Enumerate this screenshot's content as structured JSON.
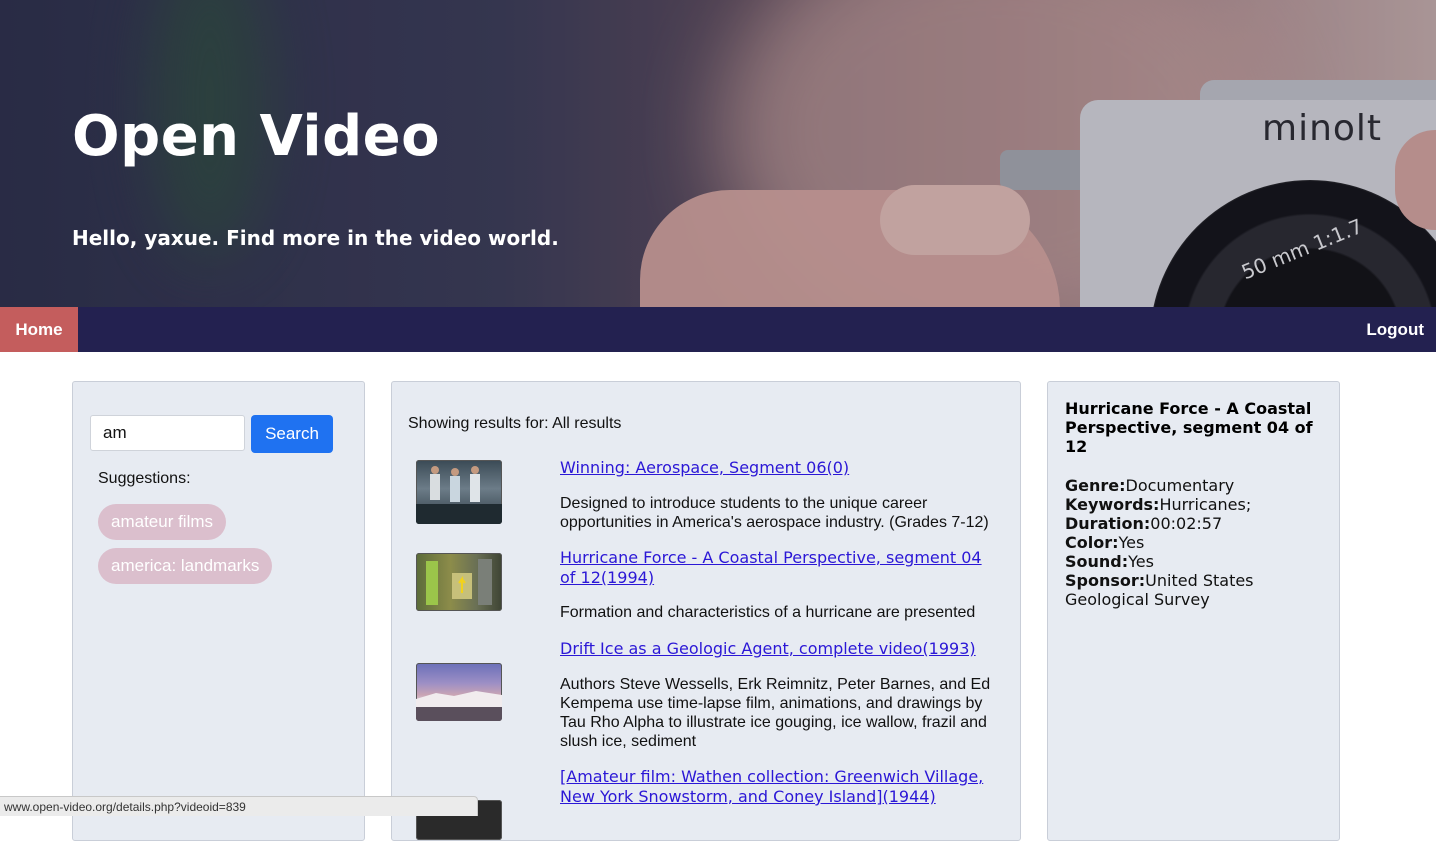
{
  "hero": {
    "title": "Open Video",
    "subtitle": "Hello, yaxue. Find more in the video world.",
    "camera_brand": "minolt",
    "lens_marking": "50 mm 1:1.7"
  },
  "nav": {
    "home_label": "Home",
    "logout_label": "Logout"
  },
  "search": {
    "value": "am",
    "button_label": "Search",
    "suggestions_label": "Suggestions:",
    "suggestions": [
      "amateur films",
      "america: landmarks"
    ]
  },
  "results": {
    "heading": "Showing results for: All results",
    "items": [
      {
        "title": "Winning: Aerospace, Segment 06(0)",
        "description": "Designed to introduce students to the unique career opportunities in America's aerospace industry. (Grades 7-12)"
      },
      {
        "title": "Hurricane Force - A Coastal Perspective, segment 04 of 12(1994)",
        "description": "Formation and characteristics of a hurricane are presented"
      },
      {
        "title": "Drift Ice as a Geologic Agent, complete video(1993)",
        "description": "Authors Steve Wessells, Erk Reimnitz, Peter Barnes, and Ed Kempema use time-lapse film, animations, and drawings by Tau Rho Alpha to illustrate ice gouging, ice wallow, frazil and slush ice, sediment"
      },
      {
        "title": "[Amateur film: Wathen collection: Greenwich Village, New York Snowstorm, and Coney Island](1944)",
        "description": ""
      }
    ]
  },
  "detail": {
    "title": "Hurricane Force - A Coastal Perspective, segment 04 of 12",
    "genre_label": "Genre:",
    "genre": "Documentary",
    "keywords_label": "Keywords:",
    "keywords": "Hurricanes;",
    "duration_label": "Duration:",
    "duration": "00:02:57",
    "color_label": "Color:",
    "color": "Yes",
    "sound_label": "Sound:",
    "sound": "Yes",
    "sponsor_label": "Sponsor:",
    "sponsor": "United States Geological Survey"
  },
  "status_bar": {
    "url": "www.open-video.org/details.php?videoid=839"
  },
  "colors": {
    "nav_bg": "#232150",
    "home_active": "#c45d5d",
    "search_button": "#1f72f1",
    "chip_bg": "#dbbfcd",
    "link": "#2b17d6",
    "panel_bg": "#e7ebf2"
  }
}
